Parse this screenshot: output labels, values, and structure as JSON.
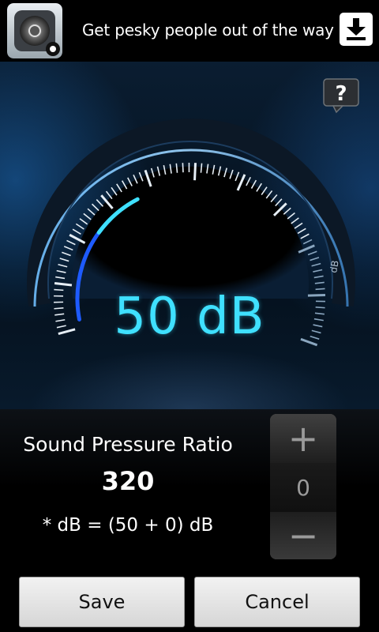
{
  "banner": {
    "text": "Get pesky people out of the way",
    "app_icon": "speaker-icon",
    "download_icon": "download-icon"
  },
  "gauge": {
    "value_text": "50 dB",
    "unit_label": "dB",
    "level_fraction": 0.36,
    "help_label": "?",
    "accent_color": "#3fe0ff"
  },
  "ratio": {
    "label": "Sound Pressure Ratio",
    "value": "320",
    "formula": "* dB = (50 + 0) dB"
  },
  "stepper": {
    "plus_label": "+",
    "value": "0",
    "minus_label": "−"
  },
  "actions": {
    "save_label": "Save",
    "cancel_label": "Cancel"
  }
}
